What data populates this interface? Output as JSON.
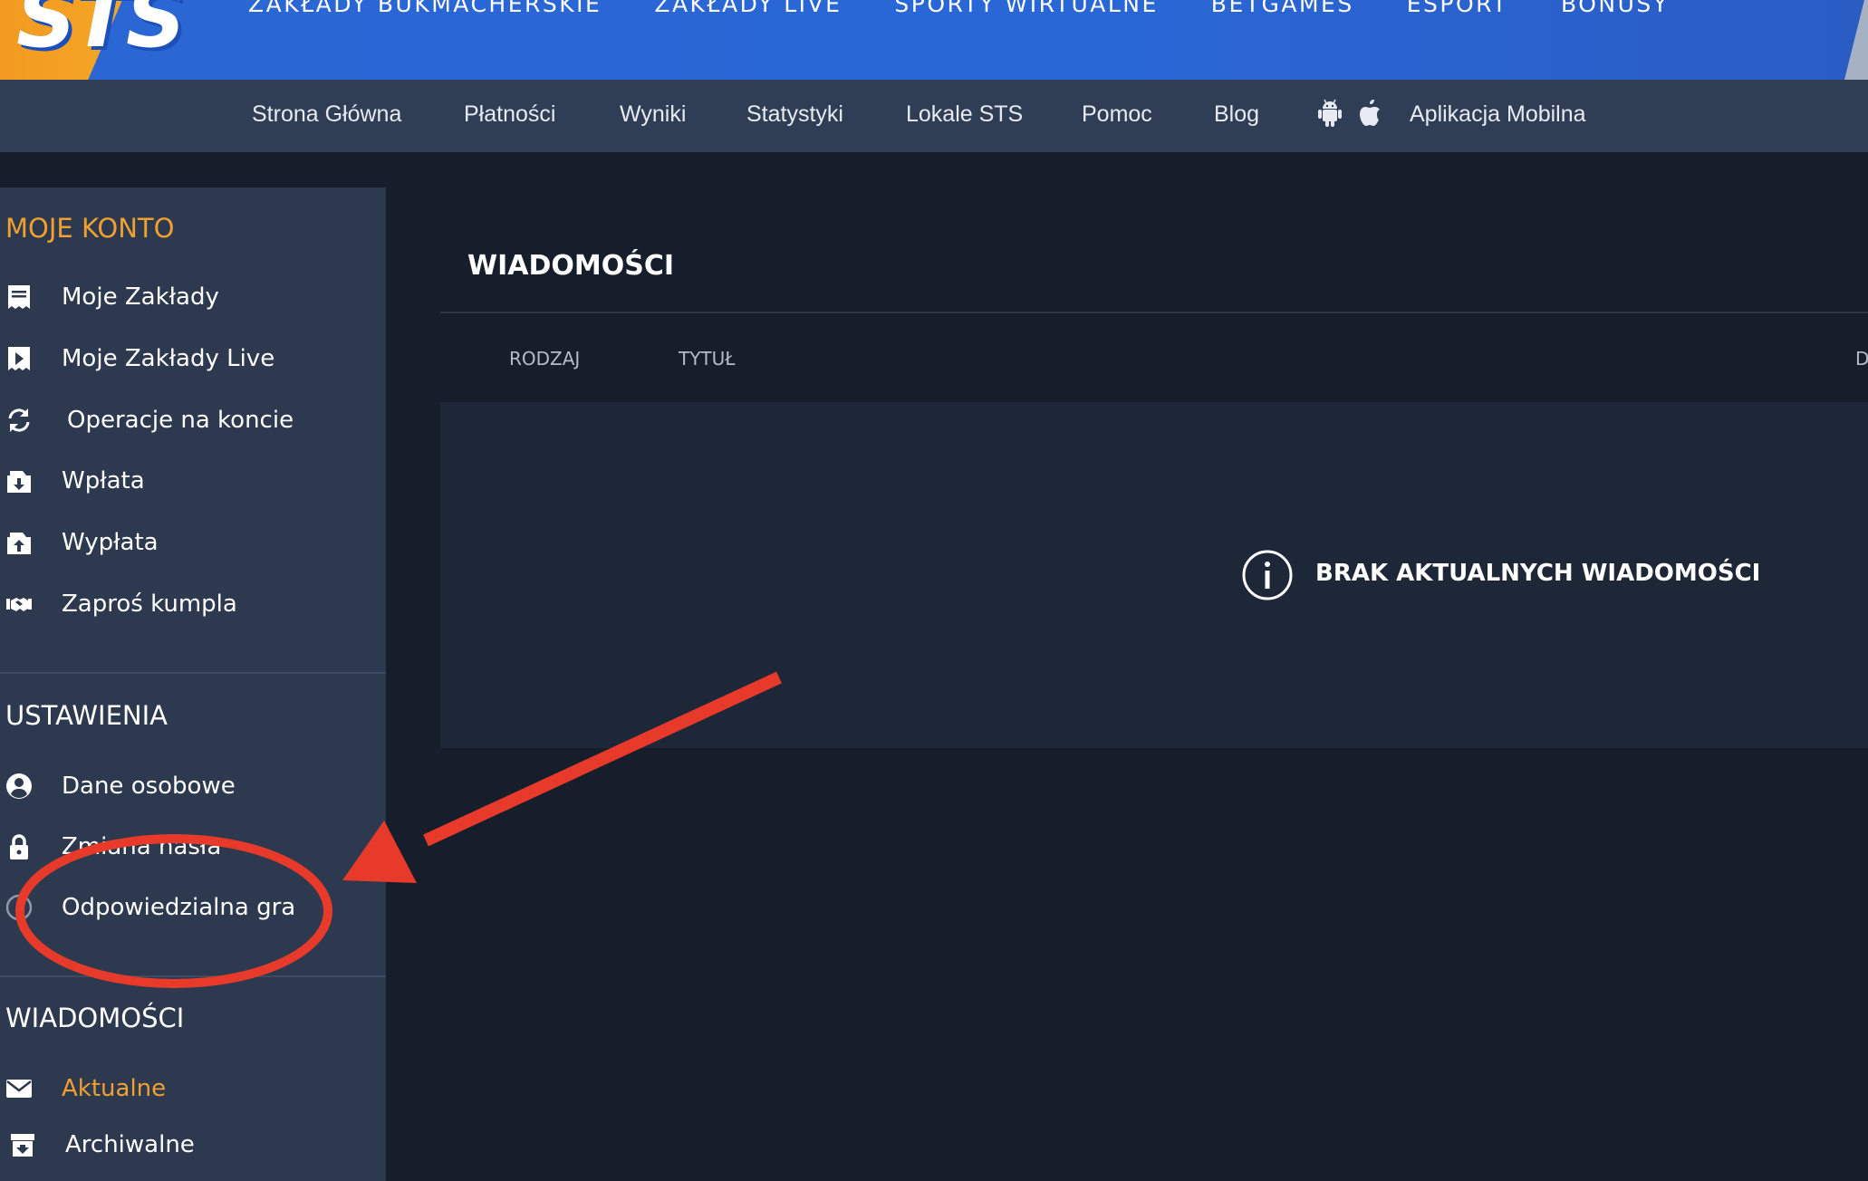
{
  "logo": {
    "text": "STS"
  },
  "main_nav": {
    "items": [
      "ZAKŁADY BUKMACHERSKIE",
      "ZAKŁADY LIVE",
      "SPORTY WIRTUALNE",
      "BETGAMES",
      "ESPORT",
      "BONUSY"
    ]
  },
  "sub_nav": {
    "items": [
      "Strona Główna",
      "Płatności",
      "Wyniki",
      "Statystyki",
      "Lokale STS",
      "Pomoc",
      "Blog"
    ],
    "mobile_app_label": "Aplikacja Mobilna"
  },
  "sidebar": {
    "my_account": {
      "title": "MOJE KONTO",
      "items": [
        {
          "label": "Moje Zakłady",
          "icon": "receipt-icon"
        },
        {
          "label": "Moje Zakłady Live",
          "icon": "live-bets-icon"
        },
        {
          "label": "Operacje na koncie",
          "icon": "refresh-icon"
        },
        {
          "label": "Wpłata",
          "icon": "deposit-icon"
        },
        {
          "label": "Wypłata",
          "icon": "withdraw-icon"
        },
        {
          "label": "Zaproś kumpla",
          "icon": "handshake-icon"
        }
      ]
    },
    "settings": {
      "title": "USTAWIENIA",
      "items": [
        {
          "label": "Dane osobowe",
          "icon": "user-icon"
        },
        {
          "label": "Zmiana hasła",
          "icon": "lock-icon"
        },
        {
          "label": "Odpowiedzialna gra",
          "icon": "responsible-gaming-icon"
        }
      ]
    },
    "messages": {
      "title": "WIADOMOŚCI",
      "items": [
        {
          "label": "Aktualne",
          "icon": "envelope-icon",
          "active": true
        },
        {
          "label": "Archiwalne",
          "icon": "archive-icon"
        }
      ]
    }
  },
  "content": {
    "title": "WIADOMOŚCI",
    "columns": [
      "RODZAJ",
      "TYTUŁ",
      "D"
    ],
    "empty_message": "BRAK AKTUALNYCH WIADOMOŚCI"
  },
  "colors": {
    "accent_orange": "#f0a030",
    "topbar_blue": "#2a66d4",
    "annotation_red": "#e83a2a"
  }
}
